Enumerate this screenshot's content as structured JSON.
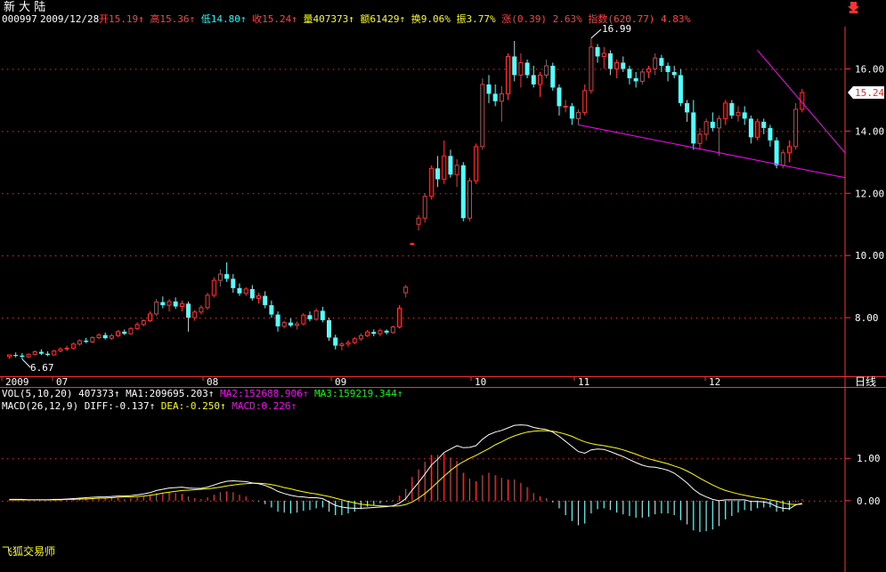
{
  "header": {
    "name": "新 大 陆",
    "code": "000997",
    "date": "2009/12/28",
    "stats": [
      {
        "label": "开",
        "value": "15.19",
        "arrow": "↑",
        "color": "#ff4040"
      },
      {
        "label": "高",
        "value": "15.36",
        "arrow": "↑",
        "color": "#ff4040"
      },
      {
        "label": "低",
        "value": "14.80",
        "arrow": "↑",
        "color": "#00ffff"
      },
      {
        "label": "收",
        "value": "15.24",
        "arrow": "↑",
        "color": "#ff4040"
      },
      {
        "label": "量",
        "value": "407373",
        "arrow": "↑",
        "color": "#ffff00"
      },
      {
        "label": "额",
        "value": "61429",
        "arrow": "↑",
        "color": "#ffff00"
      },
      {
        "label": "换",
        "value": "9.06%",
        "arrow": "",
        "color": "#ffff00"
      },
      {
        "label": "振",
        "value": "3.77%",
        "arrow": "",
        "color": "#ffff00"
      },
      {
        "label": "涨",
        "value": "(0.39)",
        "arrow": "",
        "color": "#ff4040"
      },
      {
        "label": "",
        "value": "2.63%",
        "arrow": "",
        "color": "#ff4040"
      },
      {
        "label": "指数",
        "value": "(620.77)",
        "arrow": "",
        "color": "#ff4040"
      },
      {
        "label": "",
        "value": "4.83%",
        "arrow": "",
        "color": "#ff4040"
      }
    ],
    "corner_icon": "down-arrow-icon"
  },
  "current_price_label": "15.24",
  "period_label": "日线",
  "footer_brand": "飞狐交易师",
  "vol_line": [
    {
      "text": "VOL(5,10,20)",
      "color": "#ffffff"
    },
    {
      "text": "407373↑",
      "color": "#ffffff"
    },
    {
      "text": "MA1:209695.203↑",
      "color": "#ffffff"
    },
    {
      "text": "MA2:152688.906↑",
      "color": "#ff00ff"
    },
    {
      "text": "MA3:159219.344↑",
      "color": "#00ff00"
    }
  ],
  "macd_line": [
    {
      "text": "MACD(26,12,9)",
      "color": "#ffffff"
    },
    {
      "text": "DIFF:-0.137↑",
      "color": "#ffffff"
    },
    {
      "text": "DEA:-0.250↑",
      "color": "#ffff00"
    },
    {
      "text": "MACD:0.226↑",
      "color": "#ff00ff"
    }
  ],
  "chart_data": [
    {
      "type": "candlestick",
      "price_axis": {
        "ticks": [
          "16.00",
          "14.00",
          "12.00",
          "10.00",
          "8.00"
        ],
        "ylim": [
          6.2,
          17.3
        ]
      },
      "time_axis": {
        "labels": [
          "2009",
          "07",
          "08",
          "09",
          "10",
          "11",
          "12"
        ]
      },
      "annotations": {
        "high": "16.99",
        "low": "6.67"
      },
      "up_color": "#ff3232",
      "down_color": "#54ffff",
      "ohlc": [
        [
          6.75,
          6.82,
          6.68,
          6.8
        ],
        [
          6.8,
          6.88,
          6.72,
          6.78
        ],
        [
          6.78,
          6.86,
          6.67,
          6.74
        ],
        [
          6.74,
          6.85,
          6.7,
          6.82
        ],
        [
          6.82,
          6.95,
          6.78,
          6.9
        ],
        [
          6.9,
          6.98,
          6.8,
          6.84
        ],
        [
          6.84,
          6.92,
          6.76,
          6.8
        ],
        [
          6.8,
          6.96,
          6.78,
          6.93
        ],
        [
          6.93,
          7.05,
          6.88,
          6.99
        ],
        [
          6.99,
          7.1,
          6.92,
          7.02
        ],
        [
          7.02,
          7.2,
          6.98,
          7.15
        ],
        [
          7.15,
          7.3,
          7.1,
          7.26
        ],
        [
          7.26,
          7.35,
          7.18,
          7.22
        ],
        [
          7.22,
          7.4,
          7.18,
          7.36
        ],
        [
          7.36,
          7.5,
          7.3,
          7.44
        ],
        [
          7.44,
          7.52,
          7.3,
          7.34
        ],
        [
          7.34,
          7.48,
          7.28,
          7.42
        ],
        [
          7.42,
          7.6,
          7.38,
          7.55
        ],
        [
          7.55,
          7.62,
          7.44,
          7.48
        ],
        [
          7.48,
          7.7,
          7.45,
          7.65
        ],
        [
          7.65,
          7.85,
          7.6,
          7.78
        ],
        [
          7.78,
          7.95,
          7.72,
          7.9
        ],
        [
          7.9,
          8.2,
          7.86,
          8.12
        ],
        [
          8.12,
          8.6,
          8.05,
          8.5
        ],
        [
          8.5,
          8.68,
          8.3,
          8.4
        ],
        [
          8.4,
          8.6,
          8.2,
          8.52
        ],
        [
          8.52,
          8.65,
          8.28,
          8.36
        ],
        [
          8.36,
          8.55,
          8.2,
          8.45
        ],
        [
          8.45,
          8.52,
          7.55,
          8.0
        ],
        [
          8.0,
          8.25,
          7.9,
          8.18
        ],
        [
          8.18,
          8.4,
          8.1,
          8.32
        ],
        [
          8.32,
          8.8,
          8.25,
          8.72
        ],
        [
          8.72,
          9.3,
          8.65,
          9.2
        ],
        [
          9.2,
          9.55,
          9.0,
          9.4
        ],
        [
          9.4,
          9.78,
          9.15,
          9.25
        ],
        [
          9.25,
          9.4,
          8.8,
          8.95
        ],
        [
          8.95,
          9.1,
          8.7,
          8.78
        ],
        [
          8.78,
          8.98,
          8.7,
          8.92
        ],
        [
          8.92,
          9.05,
          8.55,
          8.62
        ],
        [
          8.62,
          8.8,
          8.45,
          8.7
        ],
        [
          8.7,
          8.85,
          8.3,
          8.4
        ],
        [
          8.4,
          8.55,
          8.0,
          8.1
        ],
        [
          8.1,
          8.2,
          7.55,
          7.72
        ],
        [
          7.72,
          7.9,
          7.65,
          7.84
        ],
        [
          7.84,
          7.98,
          7.7,
          7.75
        ],
        [
          7.75,
          7.88,
          7.62,
          7.8
        ],
        [
          7.8,
          8.15,
          7.75,
          8.08
        ],
        [
          8.08,
          8.2,
          7.88,
          7.95
        ],
        [
          7.95,
          8.3,
          7.9,
          8.22
        ],
        [
          8.22,
          8.35,
          7.85,
          7.92
        ],
        [
          7.92,
          8.0,
          7.25,
          7.36
        ],
        [
          7.36,
          7.45,
          6.98,
          7.1
        ],
        [
          7.1,
          7.22,
          6.95,
          7.15
        ],
        [
          7.15,
          7.28,
          7.05,
          7.2
        ],
        [
          7.2,
          7.38,
          7.14,
          7.32
        ],
        [
          7.32,
          7.5,
          7.25,
          7.42
        ],
        [
          7.42,
          7.6,
          7.38,
          7.54
        ],
        [
          7.54,
          7.62,
          7.4,
          7.48
        ],
        [
          7.48,
          7.65,
          7.4,
          7.58
        ],
        [
          7.58,
          7.62,
          7.46,
          7.52
        ],
        [
          7.52,
          7.75,
          7.48,
          7.7
        ],
        [
          7.7,
          8.4,
          7.65,
          8.3
        ],
        [
          8.8,
          9.05,
          8.65,
          8.98
        ],
        [
          10.38,
          10.42,
          10.32,
          10.38
        ],
        [
          11.0,
          11.3,
          10.8,
          11.2
        ],
        [
          11.2,
          12.0,
          11.05,
          11.9
        ],
        [
          11.9,
          12.9,
          11.8,
          12.8
        ],
        [
          12.8,
          13.2,
          12.2,
          12.45
        ],
        [
          12.45,
          13.7,
          12.3,
          13.2
        ],
        [
          13.2,
          13.4,
          12.5,
          12.6
        ],
        [
          12.6,
          13.1,
          12.2,
          12.9
        ],
        [
          12.9,
          13.0,
          11.1,
          11.2
        ],
        [
          11.2,
          12.5,
          11.1,
          12.4
        ],
        [
          12.4,
          13.6,
          12.3,
          13.5
        ],
        [
          13.5,
          15.7,
          13.4,
          15.5
        ],
        [
          15.5,
          15.8,
          14.9,
          15.2
        ],
        [
          15.2,
          15.5,
          14.8,
          14.96
        ],
        [
          14.96,
          15.45,
          14.3,
          15.2
        ],
        [
          15.2,
          16.5,
          15.0,
          16.4
        ],
        [
          16.4,
          16.9,
          15.6,
          15.8
        ],
        [
          15.8,
          16.5,
          15.4,
          16.2
        ],
        [
          16.2,
          16.3,
          15.7,
          15.8
        ],
        [
          15.8,
          16.1,
          15.4,
          15.5
        ],
        [
          15.5,
          15.9,
          15.1,
          15.8
        ],
        [
          15.8,
          16.3,
          15.7,
          16.1
        ],
        [
          16.1,
          16.2,
          15.3,
          15.4
        ],
        [
          15.4,
          15.5,
          14.5,
          14.8
        ],
        [
          14.8,
          15.0,
          14.6,
          14.8
        ],
        [
          14.8,
          14.9,
          14.2,
          14.4
        ],
        [
          14.4,
          14.7,
          14.2,
          14.6
        ],
        [
          14.6,
          15.5,
          14.5,
          15.3
        ],
        [
          15.3,
          16.99,
          15.2,
          16.7
        ],
        [
          16.7,
          16.8,
          16.2,
          16.4
        ],
        [
          16.4,
          16.7,
          16.0,
          16.5
        ],
        [
          16.5,
          16.6,
          15.8,
          16.0
        ],
        [
          16.0,
          16.3,
          15.7,
          16.2
        ],
        [
          16.2,
          16.4,
          15.9,
          16.0
        ],
        [
          16.0,
          16.1,
          15.5,
          15.7
        ],
        [
          15.7,
          15.9,
          15.4,
          15.6
        ],
        [
          15.6,
          16.0,
          15.5,
          15.9
        ],
        [
          15.9,
          16.1,
          15.7,
          16.0
        ],
        [
          16.0,
          16.5,
          15.8,
          16.35
        ],
        [
          16.35,
          16.45,
          15.9,
          16.1
        ],
        [
          16.1,
          16.2,
          15.6,
          15.9
        ],
        [
          15.9,
          16.1,
          15.7,
          15.8
        ],
        [
          15.8,
          16.0,
          14.8,
          14.9
        ],
        [
          14.9,
          15.0,
          14.3,
          14.6
        ],
        [
          14.6,
          15.0,
          13.4,
          13.6
        ],
        [
          13.6,
          14.1,
          13.4,
          13.9
        ],
        [
          13.9,
          14.4,
          13.7,
          14.3
        ],
        [
          14.3,
          14.6,
          14.0,
          14.1
        ],
        [
          14.1,
          14.5,
          13.2,
          14.4
        ],
        [
          14.4,
          15.0,
          14.2,
          14.9
        ],
        [
          14.9,
          15.0,
          14.4,
          14.5
        ],
        [
          14.5,
          14.8,
          14.3,
          14.6
        ],
        [
          14.6,
          14.8,
          14.2,
          14.4
        ],
        [
          14.4,
          14.5,
          13.6,
          13.8
        ],
        [
          13.8,
          14.4,
          13.7,
          14.3
        ],
        [
          14.3,
          14.4,
          13.9,
          14.1
        ],
        [
          14.1,
          14.2,
          13.5,
          13.7
        ],
        [
          13.7,
          13.8,
          12.8,
          12.9
        ],
        [
          12.9,
          13.4,
          12.8,
          13.3
        ],
        [
          13.3,
          13.7,
          13.0,
          13.5
        ],
        [
          13.5,
          14.9,
          13.4,
          14.7
        ],
        [
          14.7,
          15.36,
          14.6,
          15.24
        ]
      ],
      "trendlines": [
        {
          "from": [
            117,
            16.6
          ],
          "to": "right-edge",
          "to_value": 13.3
        },
        {
          "from": [
            89,
            14.2
          ],
          "to": "right-edge",
          "to_value": 12.5
        }
      ]
    },
    {
      "type": "macd",
      "yticks": [
        "1.00",
        "0.00"
      ],
      "ylim": [
        -1.2,
        1.95
      ],
      "diff_color": "#ffffff",
      "dea_color": "#ffff00",
      "pos_bar_color": "#ff3232",
      "neg_bar_color": "#54ffff",
      "diff": [
        0.03,
        0.03,
        0.03,
        0.02,
        0.02,
        0.02,
        0.02,
        0.03,
        0.03,
        0.04,
        0.05,
        0.06,
        0.07,
        0.08,
        0.09,
        0.09,
        0.1,
        0.11,
        0.11,
        0.12,
        0.14,
        0.16,
        0.19,
        0.24,
        0.27,
        0.3,
        0.31,
        0.32,
        0.3,
        0.29,
        0.29,
        0.32,
        0.37,
        0.42,
        0.46,
        0.47,
        0.46,
        0.45,
        0.42,
        0.4,
        0.36,
        0.3,
        0.22,
        0.17,
        0.13,
        0.1,
        0.09,
        0.07,
        0.07,
        0.05,
        -0.03,
        -0.11,
        -0.15,
        -0.17,
        -0.18,
        -0.18,
        -0.17,
        -0.16,
        -0.15,
        -0.14,
        -0.12,
        -0.06,
        0.05,
        0.25,
        0.43,
        0.63,
        0.84,
        0.98,
        1.14,
        1.22,
        1.3,
        1.25,
        1.26,
        1.3,
        1.45,
        1.56,
        1.62,
        1.66,
        1.72,
        1.78,
        1.79,
        1.78,
        1.73,
        1.7,
        1.68,
        1.62,
        1.52,
        1.4,
        1.28,
        1.16,
        1.12,
        1.2,
        1.22,
        1.21,
        1.16,
        1.1,
        1.04,
        0.97,
        0.9,
        0.84,
        0.8,
        0.79,
        0.76,
        0.72,
        0.65,
        0.54,
        0.42,
        0.27,
        0.16,
        0.09,
        0.03,
        0.0,
        0.02,
        0.02,
        0.02,
        0.02,
        -0.02,
        -0.02,
        -0.03,
        -0.06,
        -0.14,
        -0.18,
        -0.19,
        -0.1,
        -0.06
      ],
      "dea": [
        0.02,
        0.02,
        0.02,
        0.02,
        0.02,
        0.02,
        0.02,
        0.02,
        0.02,
        0.03,
        0.03,
        0.04,
        0.04,
        0.05,
        0.06,
        0.06,
        0.07,
        0.08,
        0.09,
        0.09,
        0.1,
        0.11,
        0.13,
        0.15,
        0.18,
        0.2,
        0.22,
        0.24,
        0.25,
        0.26,
        0.27,
        0.28,
        0.3,
        0.32,
        0.35,
        0.37,
        0.39,
        0.4,
        0.41,
        0.41,
        0.4,
        0.38,
        0.35,
        0.31,
        0.28,
        0.24,
        0.21,
        0.18,
        0.16,
        0.13,
        0.1,
        0.06,
        0.02,
        -0.02,
        -0.05,
        -0.08,
        -0.1,
        -0.11,
        -0.12,
        -0.13,
        -0.13,
        -0.12,
        -0.09,
        -0.03,
        0.06,
        0.17,
        0.3,
        0.44,
        0.58,
        0.71,
        0.83,
        0.92,
        1.0,
        1.07,
        1.15,
        1.23,
        1.32,
        1.39,
        1.47,
        1.53,
        1.58,
        1.62,
        1.64,
        1.65,
        1.65,
        1.64,
        1.61,
        1.57,
        1.52,
        1.45,
        1.39,
        1.35,
        1.32,
        1.3,
        1.27,
        1.24,
        1.2,
        1.15,
        1.1,
        1.04,
        0.99,
        0.95,
        0.91,
        0.87,
        0.82,
        0.77,
        0.7,
        0.62,
        0.53,
        0.45,
        0.37,
        0.3,
        0.24,
        0.2,
        0.16,
        0.13,
        0.1,
        0.07,
        0.05,
        0.02,
        -0.01,
        -0.05,
        -0.08,
        -0.09,
        -0.08
      ]
    }
  ]
}
